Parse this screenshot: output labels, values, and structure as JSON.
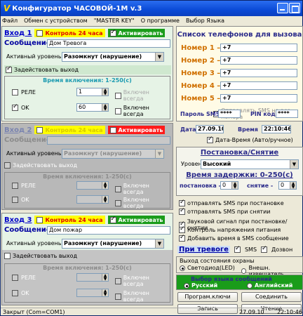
{
  "window": {
    "title": "Конфигуратор ЧАСОВОЙ-1М v.3",
    "icon": "V"
  },
  "menu": [
    "Файл",
    "Обмен с устройством",
    "\"MASTER KEY\"",
    "О программе",
    "Выбор Языка"
  ],
  "inputs": [
    {
      "title": "Вход 1",
      "control_label": "Контроль 24 часа",
      "activate_label": "Активировать",
      "control_checked": false,
      "activate_checked": true,
      "message_label": "Сообщение",
      "message_value": "Дом Тревога",
      "level_label": "Активный уровень",
      "level_value": "Разомкнут (нарушение)",
      "use_output_label": "Задействовать выход",
      "use_output_checked": true,
      "time_title": "Время включения: 1-250(с)",
      "rows": [
        {
          "label": "РЕЛЕ",
          "checked": false,
          "value": "1",
          "always_label": "Включен всегда",
          "always_checked": false
        },
        {
          "label": "OK",
          "checked": true,
          "value": "60",
          "always_label": "Включен всегда",
          "always_checked": false
        }
      ]
    },
    {
      "title": "Вход 2",
      "control_label": "Контроль 24 часа",
      "activate_label": "Активировать",
      "control_checked": false,
      "activate_checked": false,
      "message_label": "Сообщение",
      "message_value": "",
      "level_label": "Активный уровень",
      "level_value": "Разомкнут (нарушение)",
      "use_output_label": "Задействовать выход",
      "use_output_checked": false,
      "time_title": "Время включения: 1-250(с)",
      "rows": [
        {
          "label": "РЕЛЕ",
          "checked": false,
          "value": "",
          "always_label": "Включен всегда",
          "always_checked": false
        },
        {
          "label": "OK",
          "checked": false,
          "value": "",
          "always_label": "Включен всегда",
          "always_checked": false
        }
      ]
    },
    {
      "title": "Вход 3",
      "control_label": "Контроль 24 часа",
      "activate_label": "Активировать",
      "control_checked": false,
      "activate_checked": true,
      "message_label": "Сообщение",
      "message_value": "Дом пожар",
      "level_label": "Активный уровень",
      "level_value": "Разомкнут (нарушение)",
      "use_output_label": "Задействовать выход",
      "use_output_checked": false,
      "time_title": "Время включения: 1-250(с)",
      "rows": [
        {
          "label": "РЕЛЕ",
          "checked": false,
          "value": "",
          "always_label": "Включен всегда",
          "always_checked": false
        },
        {
          "label": "OK",
          "checked": false,
          "value": "",
          "always_label": "Включен всегда",
          "always_checked": false
        }
      ]
    }
  ],
  "phones": {
    "title": "Список телефонов для вызова",
    "items": [
      {
        "label": "Номер 1 –",
        "value": "+7"
      },
      {
        "label": "Номер 2 –",
        "value": "+7"
      },
      {
        "label": "Номер 3 –",
        "value": "+7"
      },
      {
        "label": "Номер 4 –",
        "value": "+7"
      },
      {
        "label": "Номер 5 –",
        "value": "+7"
      }
    ],
    "sms_all_label": "Отправлять SMS на все номера",
    "sms_pass_label": "Пароль SMS",
    "sms_pass_value": "****",
    "pin_label": "PIN код",
    "pin_value": "****",
    "date_label": "Дата",
    "date_value": "27.09.10",
    "time_label": "Время",
    "time_value": "22:10:46",
    "datetime_label": "Дата-Время (Авто/ручное)"
  },
  "arming": {
    "title": "Постановка/Снятие",
    "level_label": "Уровень",
    "level_value": "Высокий",
    "delay_title": "Время задержки: 0-250(с)",
    "arm_label": "постановка -",
    "arm_value": "0",
    "disarm_label": "снятие -",
    "disarm_value": "0",
    "checks": [
      {
        "label": "отправлять SMS при постановке",
        "checked": true
      },
      {
        "label": "отправлять SMS при снятии",
        "checked": true
      },
      {
        "label": "Звуковой сигнал при постановке/снятии",
        "checked": true
      },
      {
        "label": "Контроль напряжения питания",
        "checked": true
      },
      {
        "label": "Добавить время в SMS сообщение",
        "checked": true
      }
    ],
    "alarm_label": "При тревоге",
    "alarm_sms_label": "SMS",
    "alarm_call_label": "Дозвон"
  },
  "state_output": {
    "title": "Выход состояния охраны",
    "opt1": "Светодиод(LED)",
    "opt2": "Внешн. извещатель"
  },
  "language": {
    "title": "Выбор языка сообщений",
    "opt1": "Русский",
    "opt2": "Английский"
  },
  "buttons": {
    "prog_keys": "Програм.ключи",
    "connect": "Соединить",
    "write": "Запись",
    "read": "Чтение"
  },
  "status": {
    "left": "Закрыт (Com=COM1)",
    "date": "27.09.10",
    "time": "22:10:46"
  },
  "colors": {
    "title_bar": "#0a4ad6",
    "active_section": "#e6f3e6",
    "disabled_section": "#b8b8b8",
    "accent_orange": "#d07000"
  }
}
